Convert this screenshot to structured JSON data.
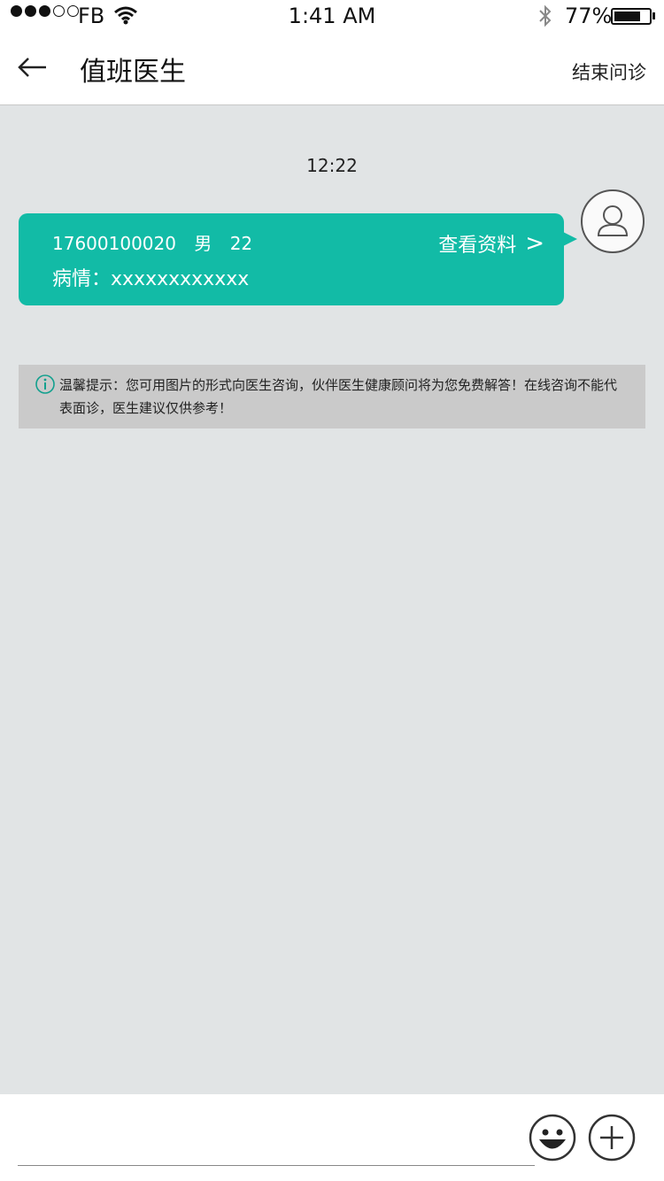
{
  "status_bar": {
    "carrier": "FB",
    "time": "1:41 AM",
    "battery_percent": "77%",
    "battery_level": 0.77,
    "signal_bars_filled": 3,
    "signal_bars_total": 5
  },
  "nav": {
    "title": "值班医生",
    "end_label": "结束问诊"
  },
  "chat": {
    "timestamp": "12:22",
    "patient_card": {
      "phone": "17600100020",
      "gender": "男",
      "age": "22",
      "condition_label": "病情：",
      "condition_value": "xxxxxxxxxxxx",
      "view_label": "查看资料",
      "view_chevron": ">"
    }
  },
  "notice": {
    "text": "温馨提示：您可用图片的形式向医生咨询，伙伴医生健康顾问将为您免费解答！在线咨询不能代表面诊，医生建议仅供参考！"
  },
  "input_bar": {
    "placeholder": ""
  },
  "colors": {
    "accent": "#12bba6",
    "background": "#e1e4e5",
    "notice_bg": "#cacaca"
  },
  "icons": {
    "back": "back-arrow-icon",
    "avatar": "user-avatar-icon",
    "info": "info-icon",
    "emoji": "smiley-icon",
    "plus": "plus-icon"
  }
}
